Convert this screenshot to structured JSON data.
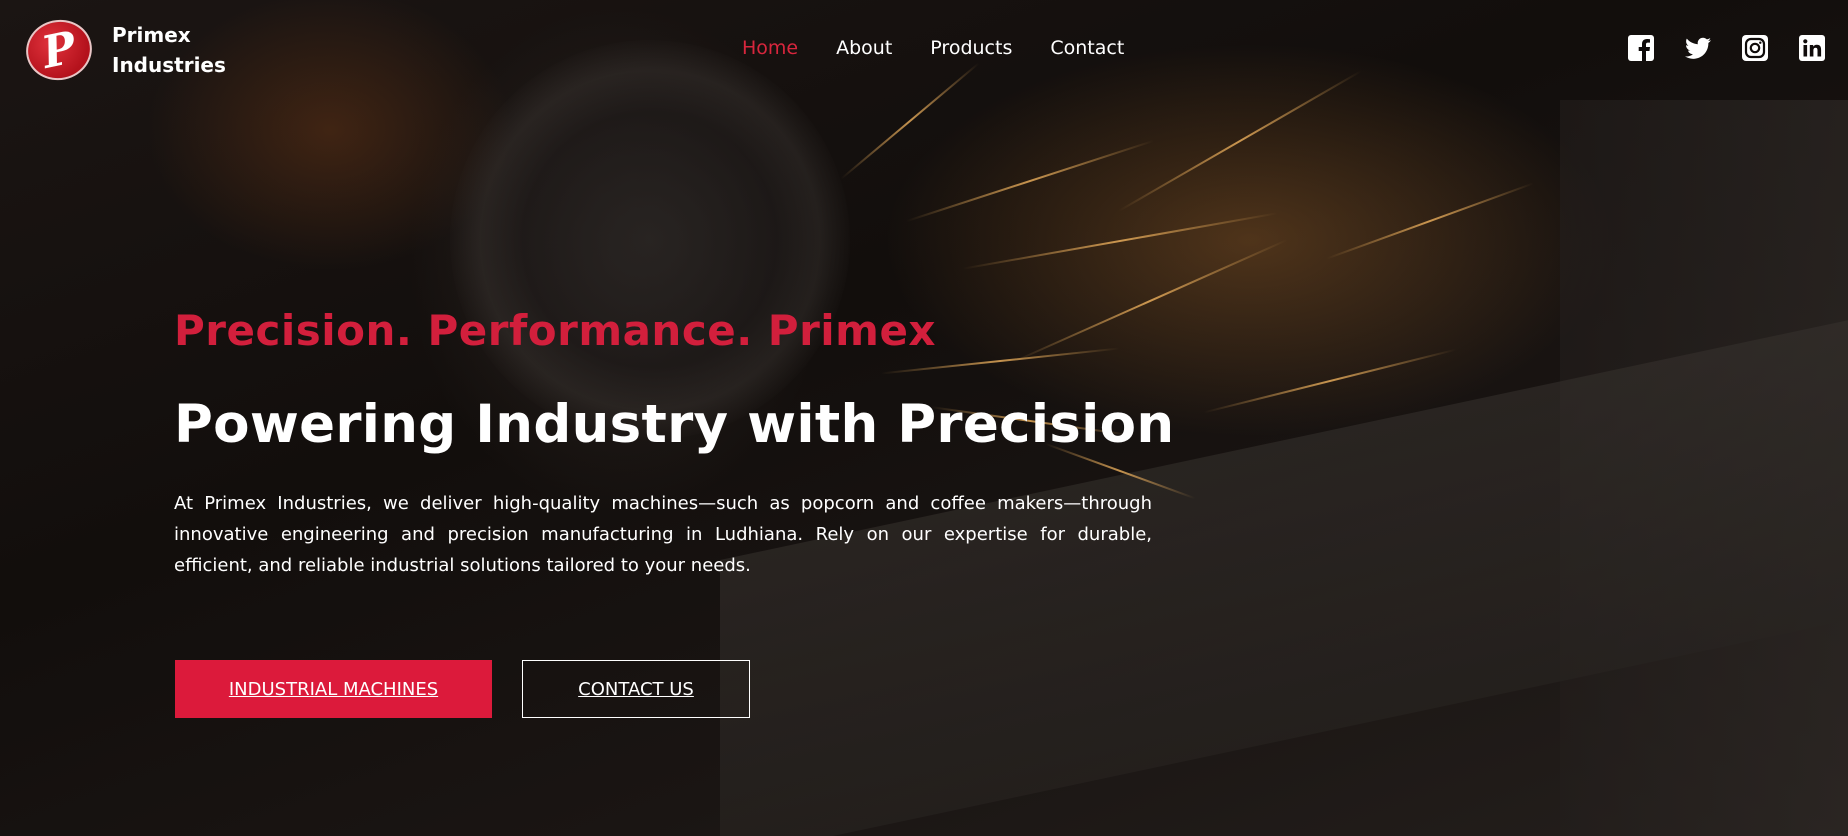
{
  "brand": {
    "logo_letter": "P",
    "name_line1": "Primex",
    "name_line2": "Industries"
  },
  "nav": {
    "items": [
      {
        "label": "Home",
        "active": true
      },
      {
        "label": "About",
        "active": false
      },
      {
        "label": "Products",
        "active": false
      },
      {
        "label": "Contact",
        "active": false
      }
    ]
  },
  "social": [
    "facebook-icon",
    "twitter-icon",
    "instagram-icon",
    "linkedin-icon"
  ],
  "hero": {
    "tagline": "Precision. Performance. Primex",
    "headline": "Powering Industry with Precision",
    "description": "At Primex Industries, we deliver high-quality machines—such as popcorn and coffee makers—through innovative engineering and precision manufacturing in Ludhiana. Rely on our expertise for durable, efficient, and reliable industrial solutions tailored to your needs.",
    "primary_button": "INDUSTRIAL MACHINES",
    "secondary_button": "CONTACT US"
  },
  "colors": {
    "accent": "#dc1a3b",
    "nav_active": "#d8263d",
    "text": "#ffffff"
  }
}
